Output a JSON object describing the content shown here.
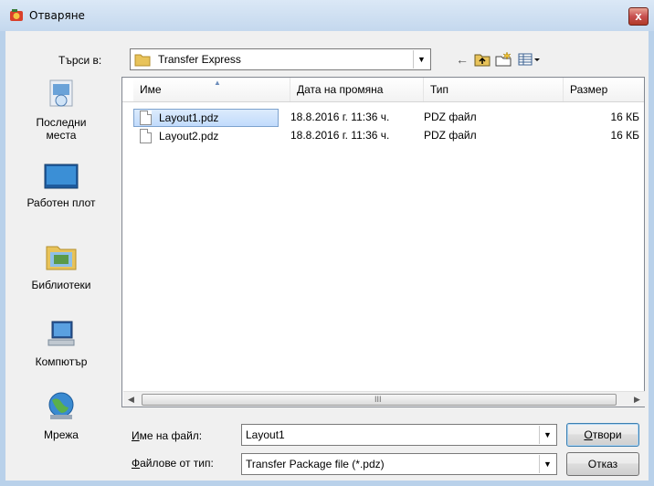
{
  "window": {
    "title": "Отваряне",
    "close_label": "x"
  },
  "lookin": {
    "label": "Търси в:",
    "value": "Transfer Express"
  },
  "toolbar": {
    "back_icon": "back-arrow-icon",
    "up_icon": "up-folder-icon",
    "newfolder_icon": "new-folder-icon",
    "views_icon": "views-menu-icon"
  },
  "places": [
    {
      "label": "Последни\nместа",
      "icon": "recent-places-icon"
    },
    {
      "label": "Работен плот",
      "icon": "desktop-icon"
    },
    {
      "label": "Библиотеки",
      "icon": "libraries-icon"
    },
    {
      "label": "Компютър",
      "icon": "computer-icon"
    },
    {
      "label": "Мрежа",
      "icon": "network-icon"
    }
  ],
  "columns": [
    "Име",
    "Дата на промяна",
    "Тип",
    "Размер"
  ],
  "files": [
    {
      "name": "Layout1.pdz",
      "date": "18.8.2016 г. 11:36 ч.",
      "type": "PDZ файл",
      "size": "16 КБ",
      "selected": true
    },
    {
      "name": "Layout2.pdz",
      "date": "18.8.2016 г. 11:36 ч.",
      "type": "PDZ файл",
      "size": "16 КБ",
      "selected": false
    }
  ],
  "scrollbar": {
    "grip": "III"
  },
  "filename": {
    "label": "Име на файл:",
    "value": "Layout1"
  },
  "filetype": {
    "label": "Файлове от тип:",
    "value": "Transfer Package file (*.pdz)"
  },
  "buttons": {
    "open": "Отвори",
    "cancel": "Отказ"
  }
}
